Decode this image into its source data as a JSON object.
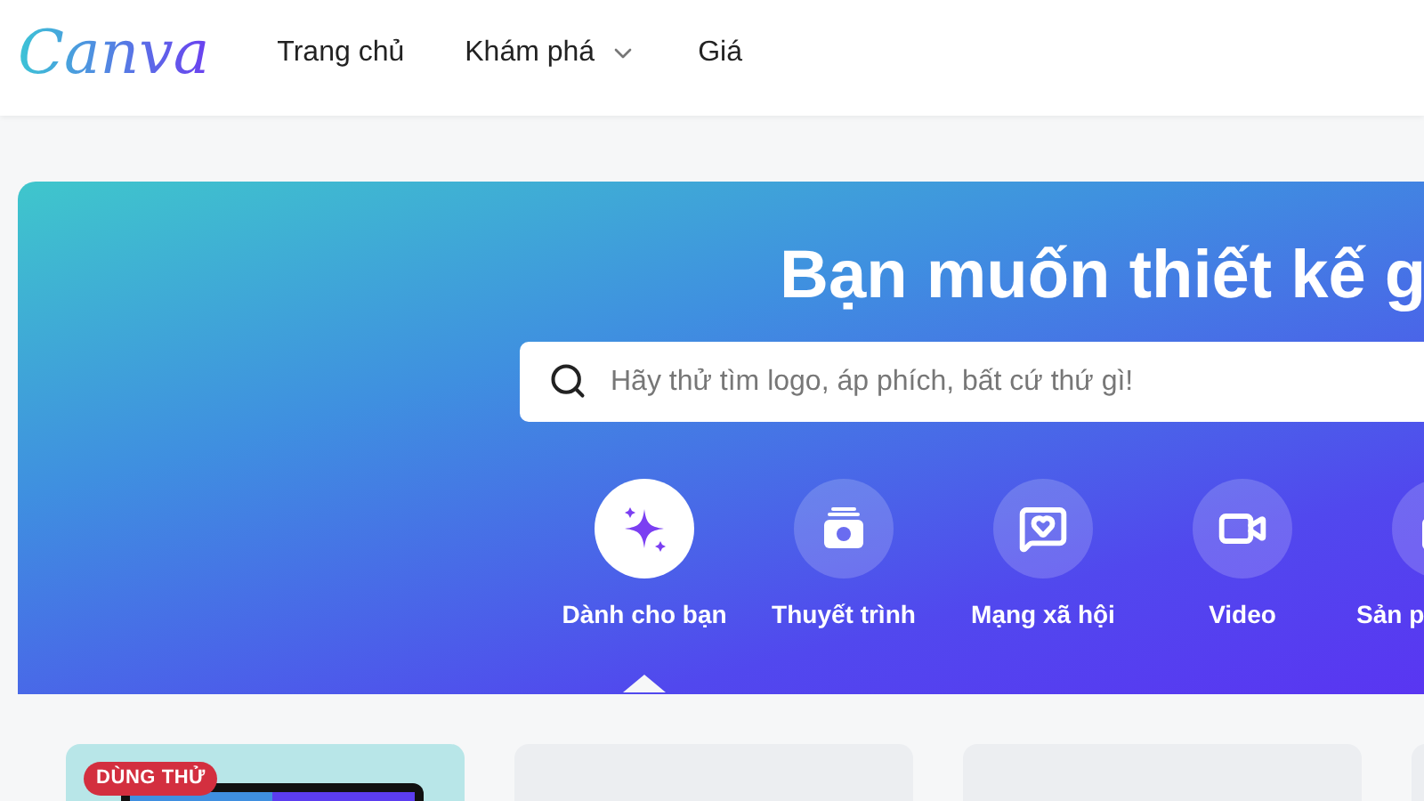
{
  "logo": "Canva",
  "nav": [
    {
      "label": "Trang chủ",
      "dropdown": false
    },
    {
      "label": "Khám phá",
      "dropdown": true
    },
    {
      "label": "Giá",
      "dropdown": false
    }
  ],
  "hero": {
    "title": "Bạn muốn thiết kế g",
    "search": {
      "placeholder": "Hãy thử tìm logo, áp phích, bất cứ thứ gì!"
    }
  },
  "categories": [
    {
      "label": "Dành cho bạn",
      "kind": "sparkle",
      "selected": true
    },
    {
      "label": "Thuyết trình",
      "kind": "presentation",
      "selected": false
    },
    {
      "label": "Mạng xã hội",
      "kind": "social",
      "selected": false
    },
    {
      "label": "Video",
      "kind": "video",
      "selected": false
    },
    {
      "label": "Sản p",
      "kind": "product",
      "selected": false
    }
  ],
  "cards": [
    {
      "kind": "design",
      "badge": "DÙNG THỬ"
    },
    {
      "kind": "loading"
    },
    {
      "kind": "loading"
    },
    {
      "kind": "loading"
    }
  ]
}
